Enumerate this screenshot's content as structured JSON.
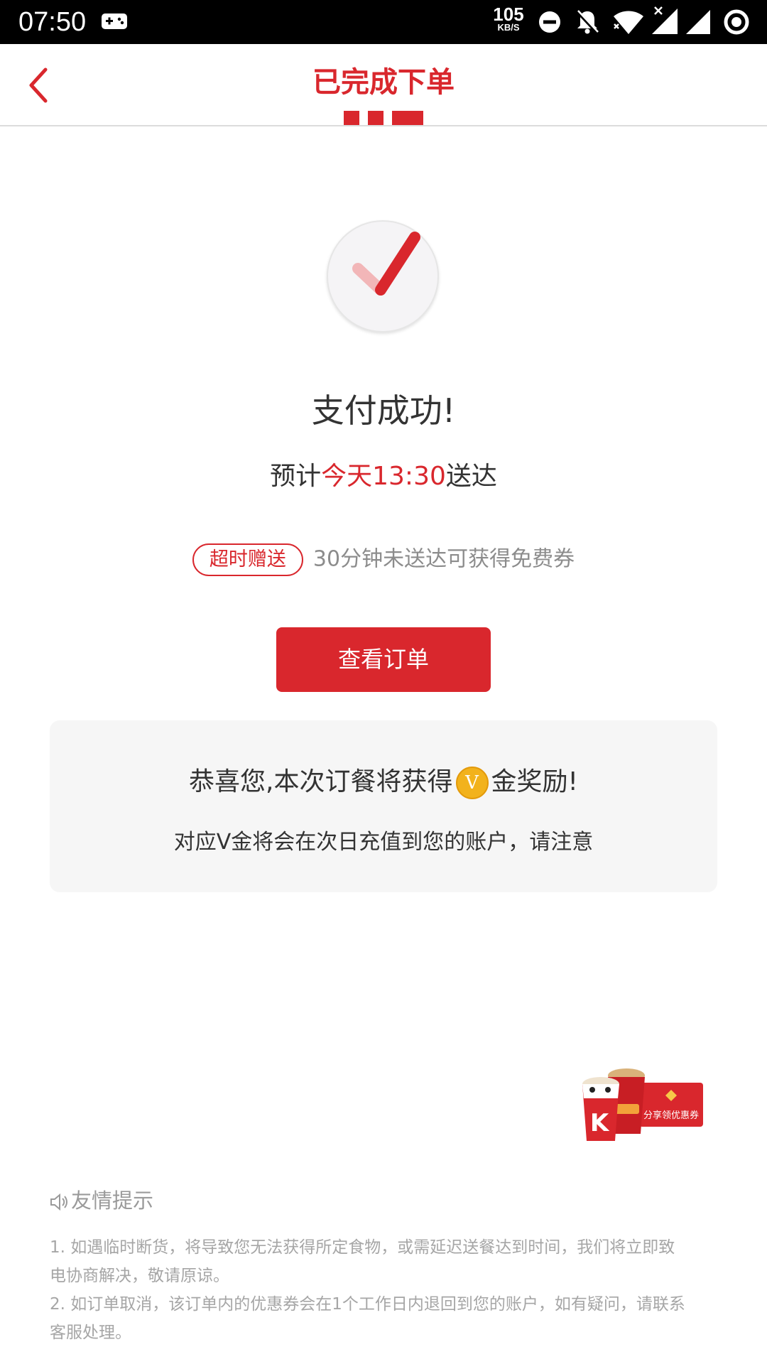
{
  "status_bar": {
    "time": "07:50",
    "net_speed": "105",
    "net_speed_unit": "KB/S",
    "icons": [
      "game-controller-icon",
      "do-not-disturb-icon",
      "notifications-off-icon",
      "wifi-icon",
      "signal-x-icon",
      "signal-icon",
      "sync-ring-icon"
    ]
  },
  "header": {
    "title": "已完成下单",
    "back_icon": "chevron-left-icon"
  },
  "colors": {
    "brand_red": "#d9272d",
    "text_dark": "#333333",
    "text_gray": "#8c8c8c",
    "coin_gold": "#f2b21c"
  },
  "success": {
    "icon": "check-icon",
    "title": "支付成功!",
    "eta_prefix": "预计",
    "eta_time": "今天13:30",
    "eta_suffix": "送达"
  },
  "overtime": {
    "badge": "超时赠送",
    "text": "30分钟未送达可获得免费券"
  },
  "actions": {
    "view_order": "查看订单"
  },
  "reward": {
    "line1_prefix": "恭喜您,本次订餐将获得",
    "coin_letter": "V",
    "line1_suffix": "金奖励!",
    "line2": "对应V金将会在次日充值到您的账户，请注意"
  },
  "promo": {
    "label": "分享领优惠券",
    "cup_letter": "K"
  },
  "tips": {
    "title": "友情提示",
    "icon": "speaker-icon",
    "item1_line1": "1. 如遇临时断货，将导致您无法获得所定食物，或需延迟送餐达到时间，我们将立即致",
    "item1_line2": "电协商解决，敬请原谅。",
    "item2_line1": "2. 如订单取消，该订单内的优惠券会在1个工作日内退回到您的账户，如有疑问，请联系",
    "item2_line2": "客服处理。"
  }
}
